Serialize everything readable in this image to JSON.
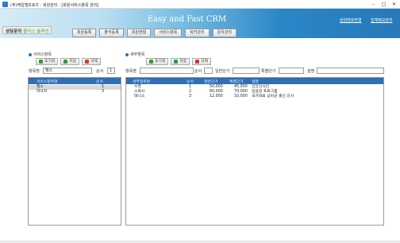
{
  "window": {
    "title": "(주)케일엠프로즈 : 회원관리 - [회원서비스항목 관리]",
    "minimize": "–",
    "maximize": "□",
    "close": "✕"
  },
  "header": {
    "logo_main": "상담문의",
    "logo_sub": "플러스 솔루션",
    "crm_title": "Easy and Fast CRM",
    "top_links": [
      "상담변호변경",
      "업체정보관리"
    ],
    "menu": [
      "회원등록",
      "출석등록",
      "회원현황",
      "서비스항목",
      "락커관리",
      "문자관리"
    ]
  },
  "left": {
    "section_title": "서비스항목",
    "buttons": {
      "reset": "초기화",
      "save": "저장",
      "delete": "삭제"
    },
    "field_name_label": "항목명",
    "field_name_value": "헬스",
    "field_order_label": "순서",
    "field_order_value": "1",
    "columns": [
      "서비스항목명",
      "순서"
    ],
    "rows": [
      {
        "name": "헬스",
        "order": "1"
      },
      {
        "name": "마사지",
        "order": "3"
      }
    ]
  },
  "right": {
    "section_title": "세부항목",
    "buttons": {
      "reset": "초기화",
      "save": "저장",
      "delete": "삭제"
    },
    "labels": {
      "name": "항목명",
      "order": "순서",
      "price": "일반단가",
      "special": "특별단가",
      "desc": "설명"
    },
    "values": {
      "name": "",
      "order": "",
      "price": "",
      "special": "",
      "desc": ""
    },
    "columns": [
      "세부항목명",
      "순서",
      "일반단가",
      "특별단가",
      "설명"
    ],
    "rows": [
      {
        "name": "수영",
        "order": "1",
        "price": "50,000",
        "special": "45,000",
        "desc": "건강강사진"
      },
      {
        "name": "스쿼시",
        "order": "2",
        "price": "60,000",
        "special": "70,000",
        "desc": "김실장 프로그램"
      },
      {
        "name": "테니스",
        "order": "3",
        "price": "12,000",
        "special": "10,000",
        "desc": "국가대표 상비군 출신 강사"
      }
    ]
  }
}
